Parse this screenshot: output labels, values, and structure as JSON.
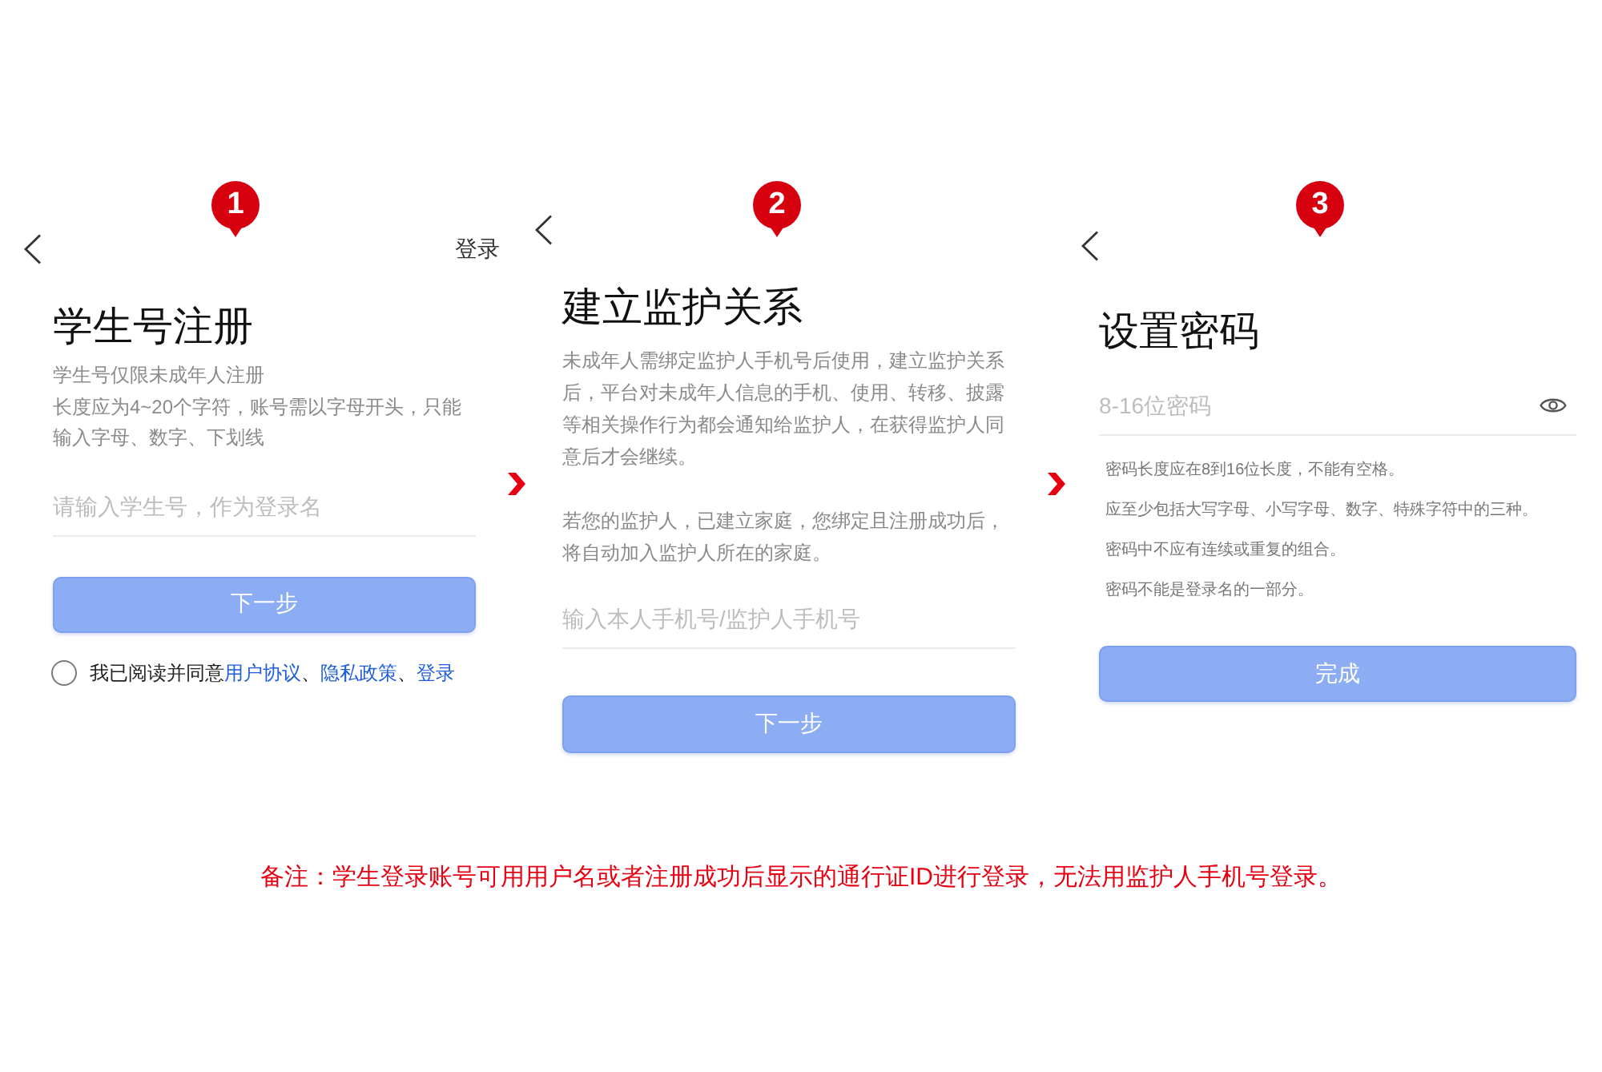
{
  "screens": [
    {
      "kind": "student_id",
      "step": "1",
      "header_action": "登录",
      "title": "学生号注册",
      "description": [
        "学生号仅限未成年人注册",
        "长度应为4~20个字符，账号需以字母开头，只能输入字母、数字、下划线"
      ],
      "input": {
        "placeholder": "请输入学生号，作为登录名"
      },
      "button": {
        "label": "下一步",
        "disabled": true
      },
      "agreement": {
        "checked": false,
        "segments": [
          {
            "kind": "plain",
            "text": "我已阅读并同意"
          },
          {
            "kind": "link",
            "text": "用户协议"
          },
          {
            "kind": "plain",
            "text": "、"
          },
          {
            "kind": "link",
            "text": "隐私政策"
          },
          {
            "kind": "plain",
            "text": "、"
          },
          {
            "kind": "link",
            "text": "登录"
          }
        ]
      }
    },
    {
      "kind": "guardian",
      "step": "2",
      "title": "建立监护关系",
      "description": [
        "未成年人需绑定监护人手机号后使用，建立监护关系后，平台对未成年人信息的手机、使用、转移、披露等相关操作行为都会通知给监护人，在获得监护人同意后才会继续。",
        "若您的监护人，已建立家庭，您绑定且注册成功后，将自动加入监护人所在的家庭。"
      ],
      "input": {
        "placeholder": "输入本人手机号/监护人手机号"
      },
      "button": {
        "label": "下一步",
        "disabled": true
      }
    },
    {
      "kind": "password",
      "step": "3",
      "title": "设置密码",
      "input": {
        "placeholder": "8-16位密码"
      },
      "rules": [
        "密码长度应在8到16位长度，不能有空格。",
        "应至少包括大写字母、小写字母、数字、特殊字符中的三种。",
        "密码中不应有连续或重复的组合。",
        "密码不能是登录名的一部分。"
      ],
      "button": {
        "label": "完成",
        "disabled": true
      }
    }
  ],
  "note": "备注：学生登录账号可用用户名或者注册成功后显示的通行证ID进行登录，无法用监护人手机号登录。"
}
